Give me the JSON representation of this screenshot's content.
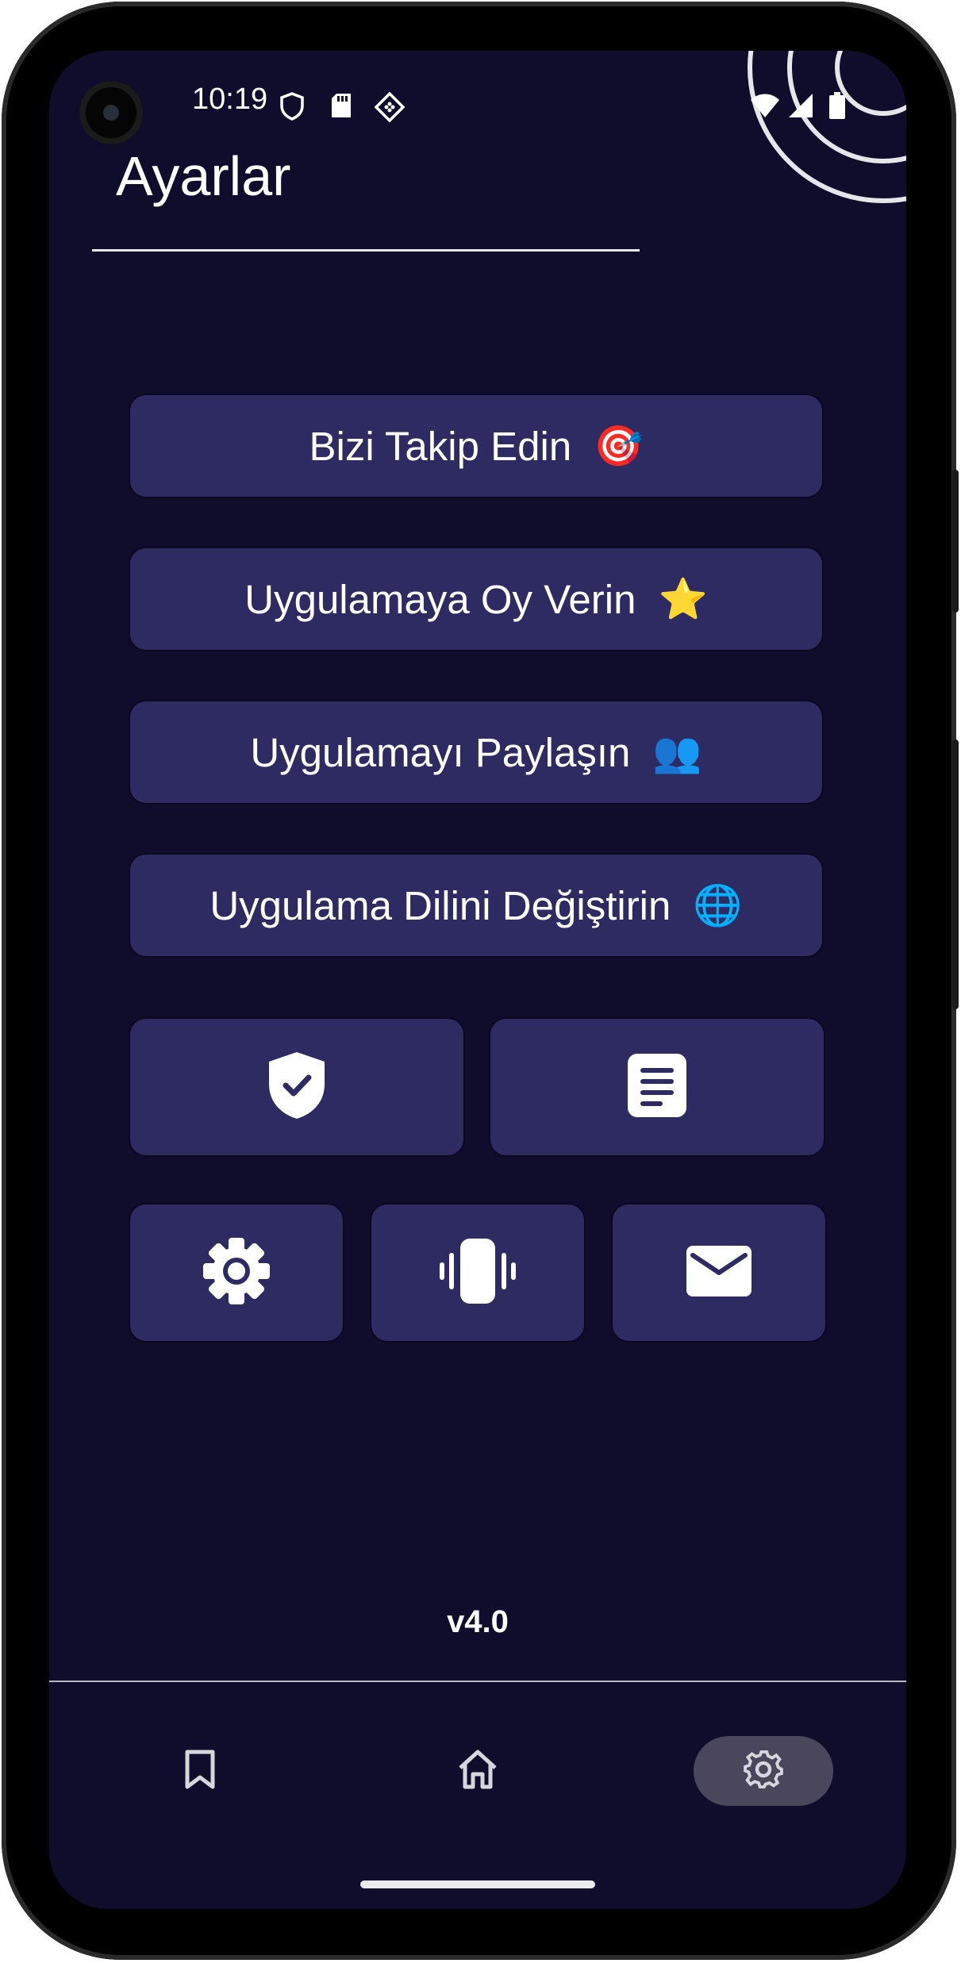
{
  "status_bar": {
    "time": "10:19",
    "icons": [
      "shield-icon",
      "sd-card-icon",
      "app-notification-icon",
      "wifi-icon",
      "cellular-signal-icon",
      "battery-icon"
    ]
  },
  "header": {
    "title": "Ayarlar"
  },
  "menu": {
    "items": [
      {
        "label": "Bizi Takip Edin",
        "emoji": "🎯"
      },
      {
        "label": "Uygulamaya Oy Verin",
        "emoji": "⭐"
      },
      {
        "label": "Uygulamayı Paylaşın",
        "emoji": "👥"
      },
      {
        "label": "Uygulama Dilini Değiştirin",
        "emoji": "🌐"
      }
    ]
  },
  "tiles": {
    "row1": [
      "privacy-shield-icon",
      "document-icon"
    ],
    "row2": [
      "theme-gear-icon",
      "vibration-icon",
      "mail-icon"
    ]
  },
  "version": "v4.0",
  "bottom_nav": {
    "items": [
      "bookmark-icon",
      "home-icon",
      "settings-gear-icon"
    ],
    "active": "settings-gear-icon"
  },
  "colors": {
    "background": "#0f0d2b",
    "button": "#2e2a62",
    "nav_active": "#4a475c",
    "text": "#ffffff"
  }
}
